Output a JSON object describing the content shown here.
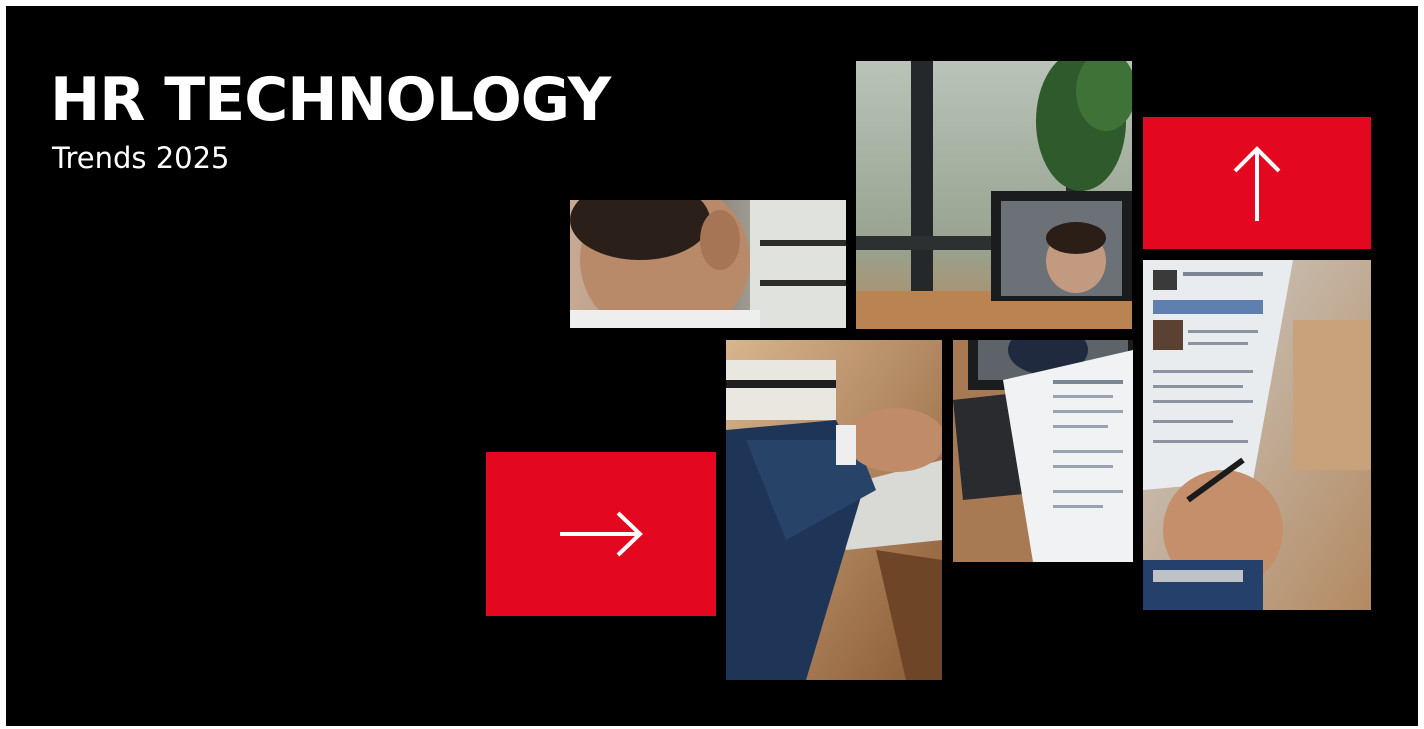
{
  "header": {
    "title": "HR TECHNOLOGY",
    "subtitle": "Trends 2025"
  },
  "icons": {
    "up_arrow": "arrow-up-icon",
    "right_arrow": "arrow-right-icon"
  },
  "colors": {
    "background": "#000000",
    "accent": "#e3071f",
    "icon": "#ffffff"
  }
}
